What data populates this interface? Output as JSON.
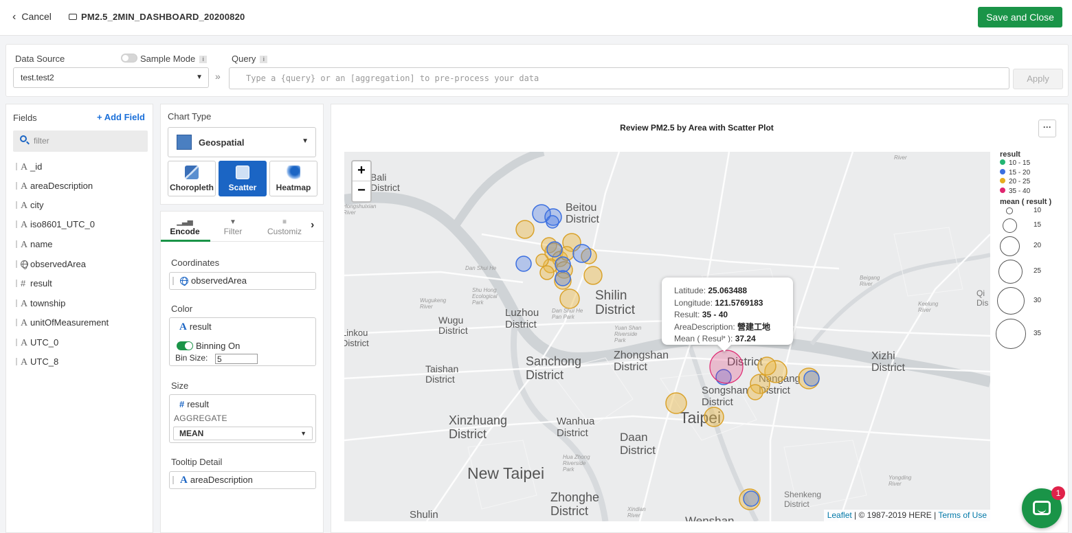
{
  "topbar": {
    "cancel_label": "Cancel",
    "doc_title": "PM2.5_2MIN_DASHBOARD_20200820",
    "save_label": "Save and Close"
  },
  "datasource": {
    "label": "Data Source",
    "sample_mode_label": "Sample Mode",
    "sample_mode_on": false,
    "query_label": "Query",
    "info_glyph": "i",
    "selected": "test.test2",
    "query_placeholder": "Type a {query} or an [aggregation] to pre-process your data",
    "query_value": "",
    "apply_label": "Apply"
  },
  "fields": {
    "title": "Fields",
    "add_label": "+ Add Field",
    "filter_placeholder": "filter",
    "items": [
      {
        "type": "A",
        "name": "_id"
      },
      {
        "type": "A",
        "name": "areaDescription"
      },
      {
        "type": "A",
        "name": "city"
      },
      {
        "type": "A",
        "name": "iso8601_UTC_0"
      },
      {
        "type": "A",
        "name": "name"
      },
      {
        "type": "geo",
        "name": "observedArea"
      },
      {
        "type": "#",
        "name": "result"
      },
      {
        "type": "A",
        "name": "township"
      },
      {
        "type": "A",
        "name": "unitOfMeasurement"
      },
      {
        "type": "A",
        "name": "UTC_0"
      },
      {
        "type": "A",
        "name": "UTC_8"
      }
    ]
  },
  "chart_type": {
    "title": "Chart Type",
    "selected": "Geospatial",
    "variants": [
      "Choropleth",
      "Scatter",
      "Heatmap"
    ],
    "active_variant": "Scatter"
  },
  "encode": {
    "tabs": [
      "Encode",
      "Filter",
      "Customiz"
    ],
    "active_tab": "Encode",
    "coordinates_label": "Coordinates",
    "coordinates_field": "observedArea",
    "color_label": "Color",
    "color_field": "result",
    "binning_label": "Binning On",
    "binning_on": true,
    "bin_size_label": "Bin Size:",
    "bin_size": "5",
    "size_label": "Size",
    "size_field": "result",
    "aggregate_label": "AGGREGATE",
    "aggregate_value": "MEAN",
    "tooltip_label": "Tooltip Detail",
    "tooltip_field": "areaDescription"
  },
  "chart": {
    "title": "Review PM2.5 by Area with Scatter Plot",
    "more_glyph": "···",
    "zoom_in": "+",
    "zoom_out": "−",
    "attribution_leaflet": "Leaflet",
    "attribution_text": " | © 1987-2019 HERE | ",
    "attribution_terms": "Terms of Use",
    "map_labels": {
      "bali": "Bali\nDistrict",
      "beitou": "Beitou\nDistrict",
      "shilin": "Shilin\nDistrict",
      "luzhou": "Luzhou\nDistrict",
      "wugu": "Wugu\nDistrict",
      "linkou": "Linkou\nDistrict",
      "taishan": "Taishan\nDistrict",
      "sanchong": "Sanchong\nDistrict",
      "zhongshan": "Zhongshan\nDistrict",
      "daan_top": "District",
      "songshan": "Songshan\nDistrict",
      "nangang": "Nangang\nDistrict",
      "xizhi": "Xizhi\nDistrict",
      "taipei": "Taipei",
      "xinzhuang": "Xinzhuang\nDistrict",
      "wanhua": "Wanhua\nDistrict",
      "daan": "Daan\nDistrict",
      "new_taipei": "New Taipei",
      "zhonghe": "Zhonghe\nDistrict",
      "shulin": "Shulin",
      "wenshan": "Wenshan",
      "shenkeng": "Shenkeng\nDistrict",
      "hongshuixian": "Hongshuixian\nRiver",
      "dan_shui_he": "Dan Shui He",
      "dan_shui_he_park": "Dan Shui He\nPan Park",
      "shuhong": "Shu Hong\nEcological\nPark",
      "wugukeng": "Wugukeng\nRiver",
      "yuanshan": "Yuan Shan\nRiverside\nPark",
      "huazhong": "Hua Zhong\nRiverside\nPark",
      "xindian": "Xindian\nRiver",
      "beigang": "Beigang\nRiver",
      "keelung": "Keelung\nRiver",
      "yongding": "Yongding\nRiver",
      "river_top": "River",
      "qi": "Qi\nDis"
    },
    "tooltip": {
      "lat_label": "Latitude: ",
      "lat": "25.063488",
      "lon_label": "Longitude: ",
      "lon": "121.5769183",
      "result_label": "Result: ",
      "result": "35 - 40",
      "area_label": "AreaDescription: ",
      "area": "營建工地",
      "mean_label": "Mean ( Result ): ",
      "mean": "37.24"
    },
    "legend": {
      "color_title": "result",
      "color_bins": [
        {
          "label": "10 - 15",
          "color": "#22b573"
        },
        {
          "label": "15 - 20",
          "color": "#3b6fe0"
        },
        {
          "label": "20 - 25",
          "color": "#e6ac1f"
        },
        {
          "label": "35 - 40",
          "color": "#e02670"
        }
      ],
      "size_title": "mean ( result )",
      "size_labels": [
        "10",
        "15",
        "20",
        "25",
        "30",
        "35"
      ]
    }
  },
  "chat": {
    "badge": "1"
  }
}
